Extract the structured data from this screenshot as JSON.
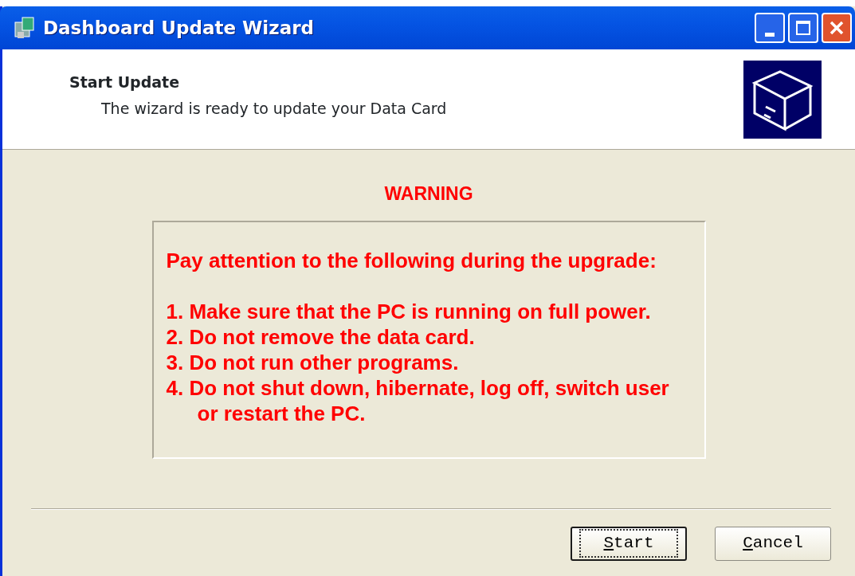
{
  "window": {
    "title": "Dashboard Update Wizard"
  },
  "header": {
    "title": "Start Update",
    "subtitle": "The wizard is ready to update your Data Card"
  },
  "warning": {
    "heading": "WARNING",
    "intro": "Pay attention to the following during the upgrade:",
    "items": [
      "1. Make sure that the PC is running on full power.",
      "2. Do not remove the data card.",
      "3. Do not run other programs.",
      "4. Do not shut down, hibernate, log off, switch user or restart the PC."
    ]
  },
  "buttons": [
    {
      "label": "Start",
      "default": true
    },
    {
      "label": "Cancel",
      "default": false
    }
  ]
}
